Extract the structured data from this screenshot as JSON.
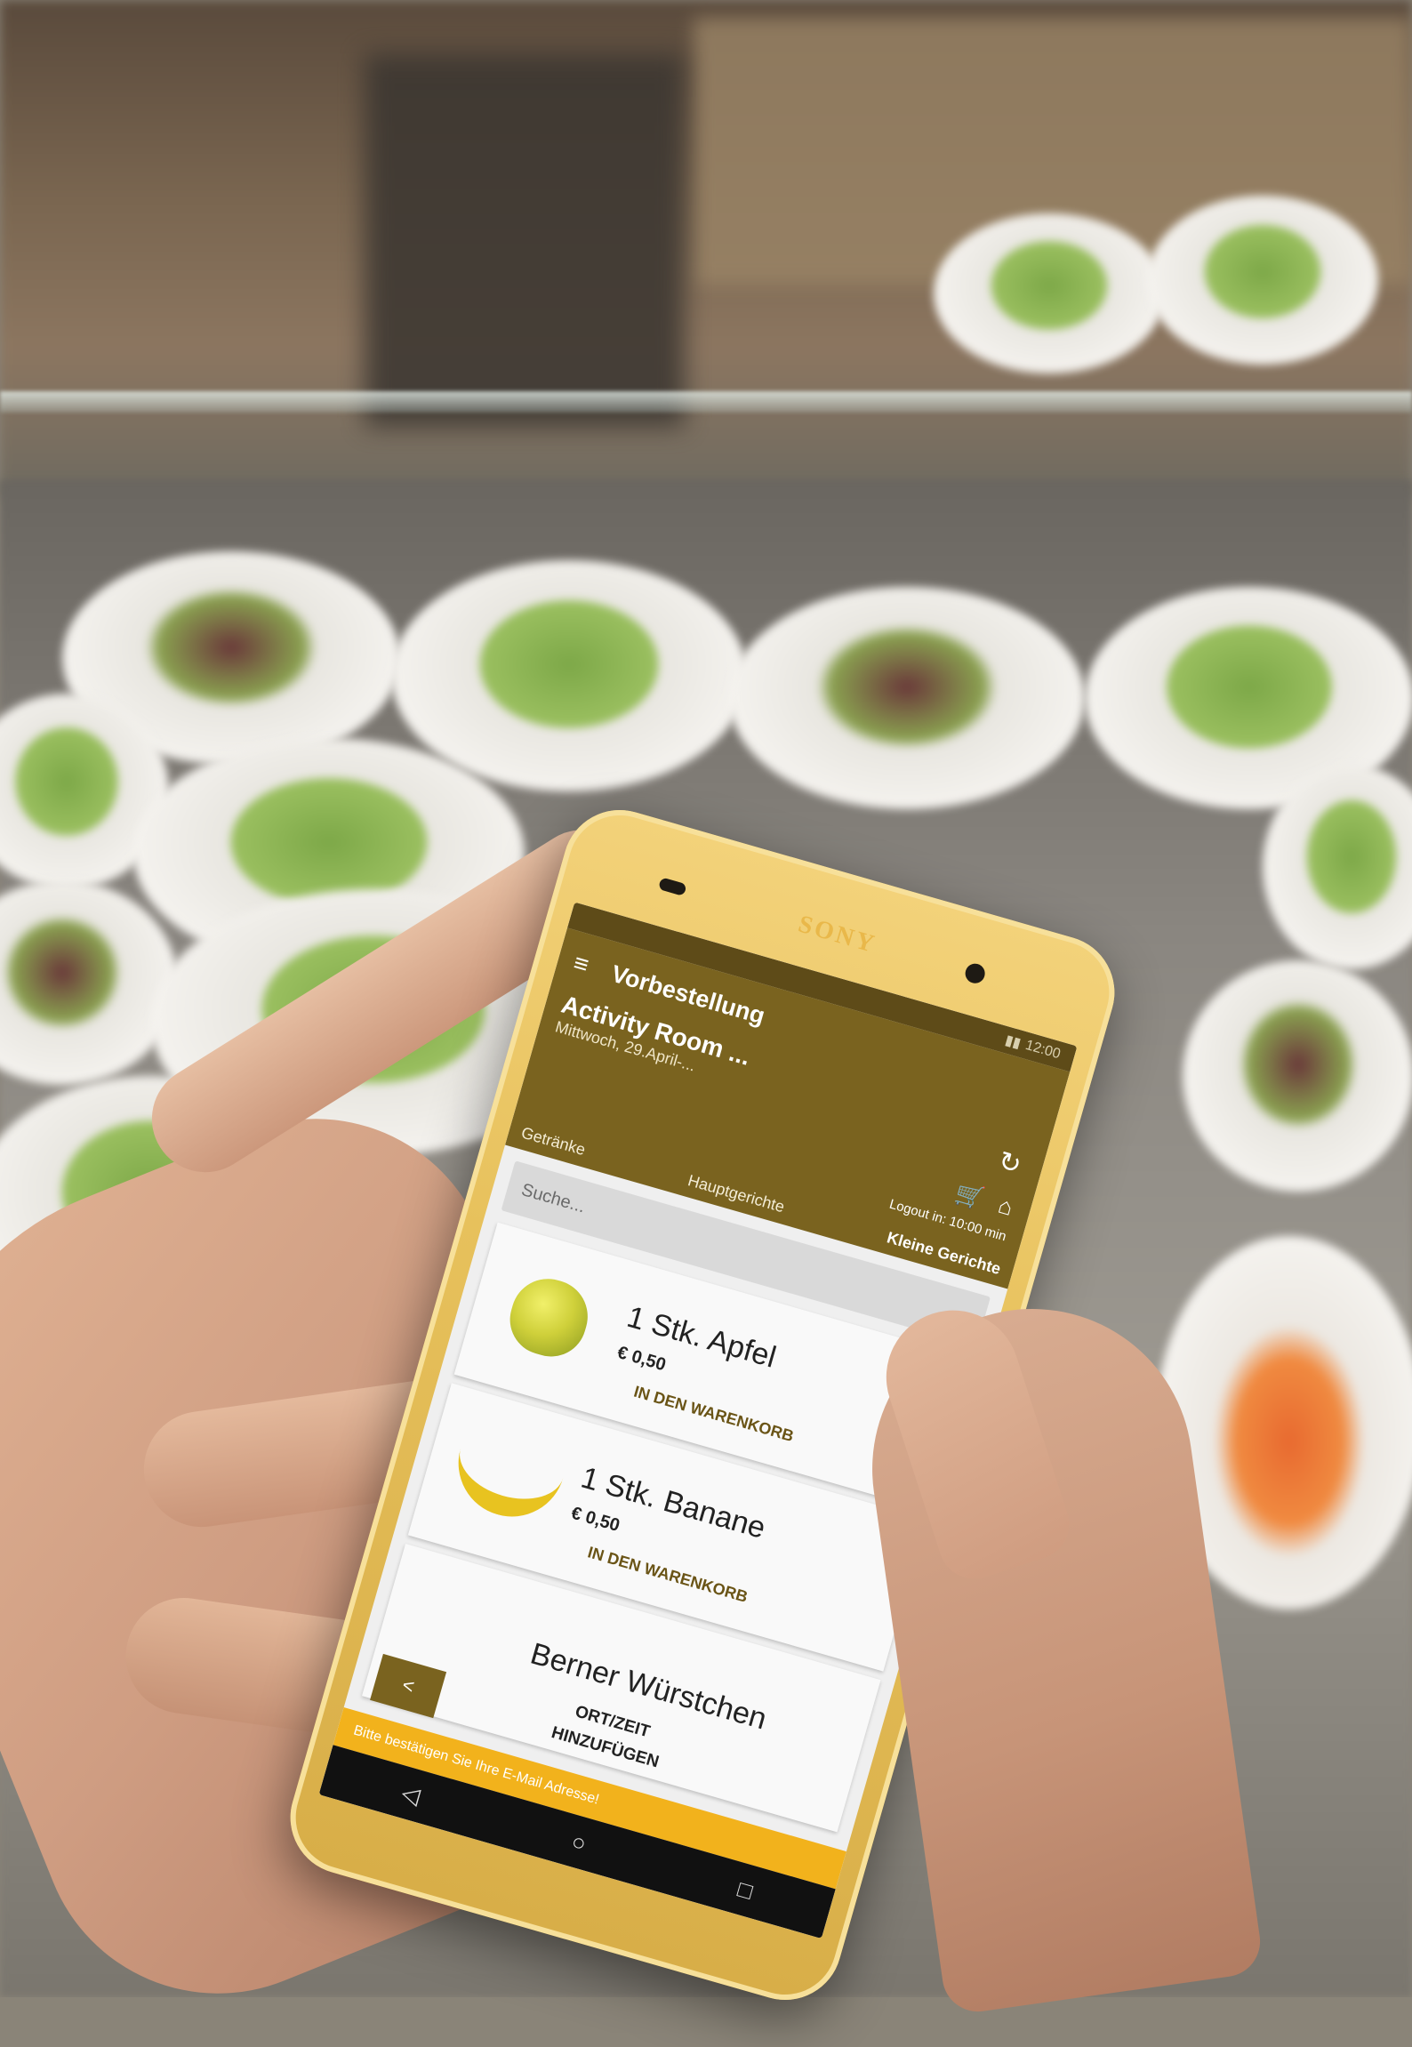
{
  "phone": {
    "brand": "SONY"
  },
  "status_bar": {
    "time": "12:00"
  },
  "app_bar": {
    "menu_icon": "hamburger-menu-icon",
    "title": "Vorbestellung",
    "location": "Activity Room ...",
    "date": "Mittwoch, 29.April-...",
    "refresh_icon": "refresh-icon",
    "cart_icon": "cart-icon",
    "home_icon": "home-icon",
    "logout_text": "Logout in: 10:00 min"
  },
  "tabs": [
    {
      "label": "Getränke"
    },
    {
      "label": "Hauptgerichte"
    },
    {
      "label": "Kleine Gerichte"
    }
  ],
  "search": {
    "placeholder": "Suche..."
  },
  "products": [
    {
      "name": "1 Stk. Apfel",
      "price": "€ 0,50",
      "add_label": "IN DEN WARENKORB"
    },
    {
      "name": "1 Stk. Banane",
      "price": "€ 0,50",
      "add_label": "IN DEN WARENKORB"
    },
    {
      "name": "Berner Würstchen",
      "price": "",
      "add_label": ""
    }
  ],
  "bottom": {
    "back_label": "<",
    "place_time_label": "ORT/ZEIT HINZUFÜGEN",
    "banner_text": "Bitte bestätigen Sie Ihre E-Mail Adresse!"
  },
  "colors": {
    "brand_brown": "#7a631f",
    "banner_yellow": "#f2b21c",
    "phone_gold": "#e7c15c"
  }
}
